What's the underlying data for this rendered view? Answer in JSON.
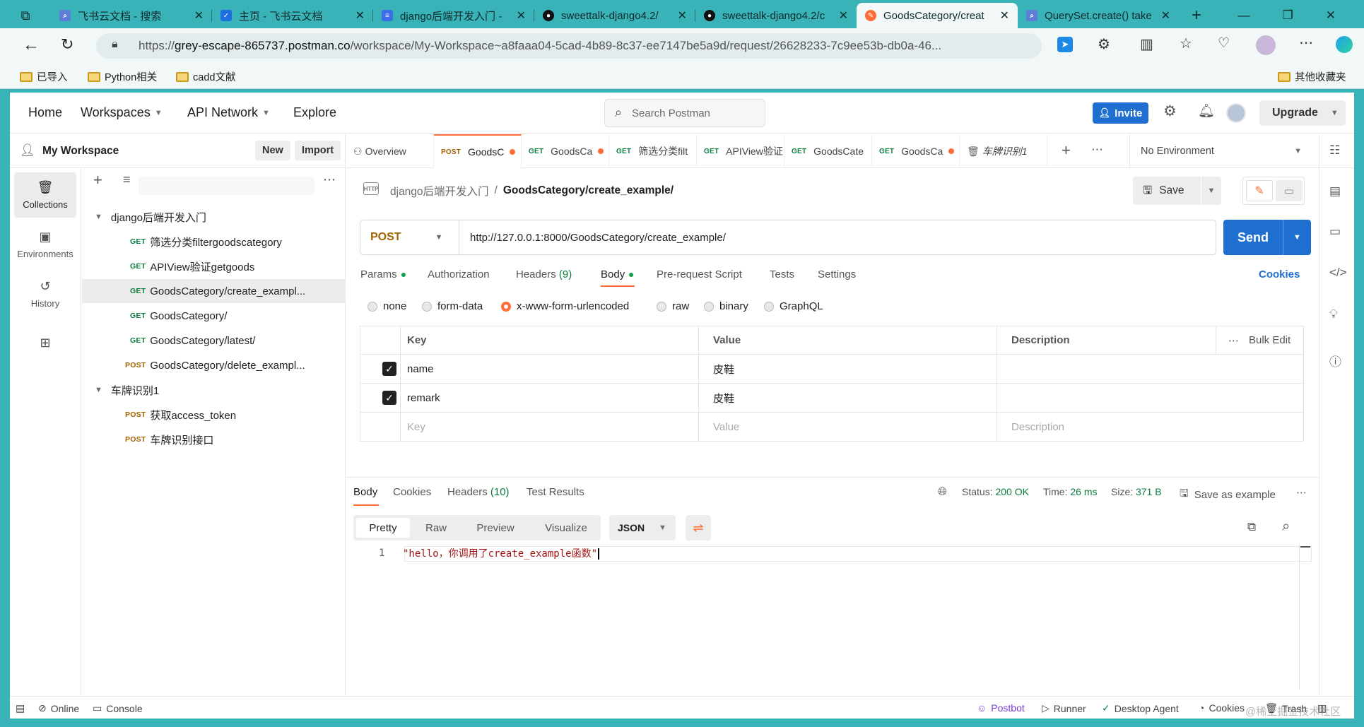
{
  "browser": {
    "tabs": [
      {
        "title": "飞书云文档 - 搜索",
        "icon": "search-icon"
      },
      {
        "title": "主页 - 飞书云文档",
        "icon": "feishu-icon"
      },
      {
        "title": "django后端开发入门 - ",
        "icon": "doc-icon"
      },
      {
        "title": "sweettalk-django4.2/",
        "icon": "github-icon"
      },
      {
        "title": "sweettalk-django4.2/c",
        "icon": "github-icon"
      },
      {
        "title": "GoodsCategory/creat",
        "icon": "postman-icon"
      },
      {
        "title": "QuerySet.create() take",
        "icon": "search-icon"
      }
    ],
    "url_scheme": "https://",
    "url_host": "grey-escape-865737.postman.co",
    "url_path": "/workspace/My-Workspace~a8faaa04-5cad-4b89-8c37-ee7147be5a9d/request/26628233-7c9ee53b-db0a-46...",
    "bookmarks": [
      "已导入",
      "Python相关",
      "cadd文献"
    ],
    "other_bookmarks": "其他收藏夹"
  },
  "topnav": {
    "home": "Home",
    "workspaces": "Workspaces",
    "api_network": "API Network",
    "explore": "Explore",
    "search_placeholder": "Search Postman",
    "invite": "Invite",
    "upgrade": "Upgrade"
  },
  "sidebar": {
    "workspace_name": "My Workspace",
    "new": "New",
    "import": "Import",
    "rail": [
      "Collections",
      "Environments",
      "History"
    ],
    "tree": [
      {
        "type": "folder",
        "label": "django后端开发入门"
      },
      {
        "type": "request",
        "method": "GET",
        "label": "筛选分类filtergoodscategory"
      },
      {
        "type": "request",
        "method": "GET",
        "label": "APIView验证getgoods"
      },
      {
        "type": "request",
        "method": "GET",
        "label": "GoodsCategory/create_exampl..."
      },
      {
        "type": "request",
        "method": "GET",
        "label": "GoodsCategory/"
      },
      {
        "type": "request",
        "method": "GET",
        "label": "GoodsCategory/latest/"
      },
      {
        "type": "request",
        "method": "POST",
        "label": "GoodsCategory/delete_exampl..."
      },
      {
        "type": "folder",
        "label": "车牌识别1"
      },
      {
        "type": "request",
        "method": "POST",
        "label": "获取access_token"
      },
      {
        "type": "request",
        "method": "POST",
        "label": "车牌识别接口"
      }
    ]
  },
  "request_tabs": {
    "overview": "Overview",
    "tabs": [
      {
        "method": "POST",
        "label": "GoodsC"
      },
      {
        "method": "GET",
        "label": "GoodsCa"
      },
      {
        "method": "GET",
        "label": "筛选分类filt"
      },
      {
        "method": "GET",
        "label": "APIView验证"
      },
      {
        "method": "GET",
        "label": "GoodsCate"
      },
      {
        "method": "GET",
        "label": "GoodsCa"
      }
    ],
    "extra_tab": "车牌识别1",
    "environment": "No Environment"
  },
  "request": {
    "breadcrumb_parent": "django后端开发入门",
    "breadcrumb_sep": "/",
    "breadcrumb_current": "GoodsCategory/create_example/",
    "save": "Save",
    "method": "POST",
    "url": "http://127.0.0.1:8000/GoodsCategory/create_example/",
    "send": "Send",
    "tabs": {
      "params": "Params",
      "authorization": "Authorization",
      "headers": "Headers",
      "headers_count": "(9)",
      "body": "Body",
      "prerequest": "Pre-request Script",
      "tests": "Tests",
      "settings": "Settings",
      "cookies": "Cookies"
    },
    "body_types": [
      "none",
      "form-data",
      "x-www-form-urlencoded",
      "raw",
      "binary",
      "GraphQL"
    ],
    "table": {
      "headers": {
        "key": "Key",
        "value": "Value",
        "description": "Description",
        "bulk_edit": "Bulk Edit"
      },
      "rows": [
        {
          "key": "name",
          "value": "皮鞋"
        },
        {
          "key": "remark",
          "value": "皮鞋"
        }
      ],
      "placeholder": {
        "key": "Key",
        "value": "Value",
        "description": "Description"
      }
    }
  },
  "response": {
    "tabs": {
      "body": "Body",
      "cookies": "Cookies",
      "headers": "Headers",
      "headers_count": "(10)",
      "test_results": "Test Results"
    },
    "status_label": "Status:",
    "status": "200 OK",
    "time_label": "Time:",
    "time": "26 ms",
    "size_label": "Size:",
    "size": "371 B",
    "save_example": "Save as example",
    "views": [
      "Pretty",
      "Raw",
      "Preview",
      "Visualize"
    ],
    "format": "JSON",
    "line": "1",
    "code": "\"hello，你调用了create_example函数\""
  },
  "statusbar": {
    "online": "Online",
    "console": "Console",
    "postbot": "Postbot",
    "runner": "Runner",
    "desktop_agent": "Desktop Agent",
    "cookies": "Cookies",
    "trash": "Trash",
    "watermark": "@稀土掘金技术社区"
  },
  "colors": {
    "accent": "#ff6c37",
    "primary": "#1f6fd1",
    "success": "#0a7c3e",
    "chrome": "#3ab3b8"
  }
}
